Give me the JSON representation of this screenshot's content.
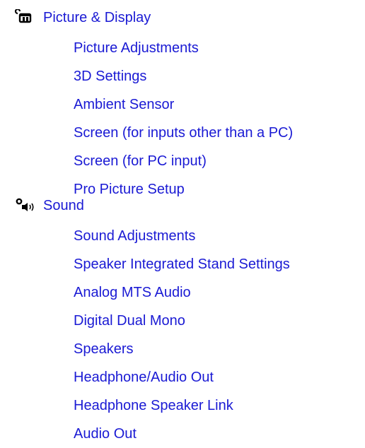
{
  "sections": [
    {
      "title": "Picture & Display",
      "icon": "picture-display-icon",
      "items": [
        "Picture Adjustments",
        "3D Settings",
        "Ambient Sensor",
        "Screen (for inputs other than a PC)",
        "Screen (for PC input)",
        "Pro Picture Setup"
      ]
    },
    {
      "title": "Sound",
      "icon": "sound-icon",
      "items": [
        "Sound Adjustments",
        "Speaker Integrated Stand Settings",
        "Analog MTS Audio",
        "Digital Dual Mono",
        "Speakers",
        "Headphone/Audio Out",
        "Headphone Speaker Link",
        "Audio Out"
      ]
    }
  ],
  "colors": {
    "link": "#1a1ad4",
    "icon": "#000000",
    "background": "#ffffff"
  }
}
